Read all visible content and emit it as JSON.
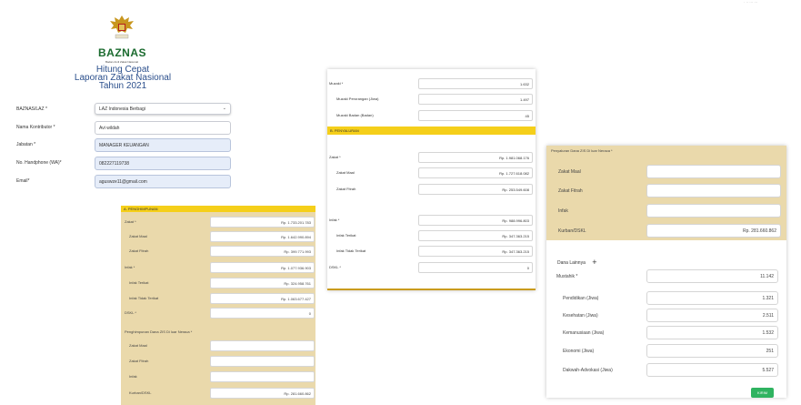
{
  "corner_text": "· ·· ··· ···",
  "header": {
    "logo_text": "BAZNAS",
    "logo_subtext": "Badan Amil Zakat Nasional",
    "title_line1": "Hitung Cepat",
    "title_line2": "Laporan Zakat Nasional",
    "title_line3": "Tahun 2021"
  },
  "form": {
    "baznas_laz": {
      "label": "BAZNAS/LAZ *",
      "value": "LAZ Indonesia Berbagi"
    },
    "kontributor": {
      "label": "Nama Kontributor *",
      "value": "Avi wildah"
    },
    "jabatan": {
      "label": "Jabatan *",
      "value": "MANAGER KEUANGAN"
    },
    "handphone": {
      "label": "No. Handphone (WA)*",
      "value": "082227119738"
    },
    "email": {
      "label": "Email*",
      "value": "aguswze11@gmail.com"
    }
  },
  "penghimpunan": {
    "header": "A. PENGHIMPUNAN",
    "rows": [
      {
        "label": "Zakat *",
        "value": "Rp. 1.733.201.783",
        "indent": false
      },
      {
        "label": "Zakat Maal",
        "value": "Rp. 1.642.990.894",
        "indent": true
      },
      {
        "label": "Zakat Fitrah",
        "value": "Rp. 399.771.993",
        "indent": true
      },
      {
        "label": "Infak *",
        "value": "Rp. 1.077.936.903",
        "indent": false
      },
      {
        "label": "Infak Terikat",
        "value": "Rp. 324.958.761",
        "indent": true
      },
      {
        "label": "Infak Tidak Terikat",
        "value": "Rp. 1.063.677.427",
        "indent": true
      },
      {
        "label": "DSKL *",
        "value": "0",
        "indent": false
      }
    ],
    "neraca_title": "Penghimpunan Dana ZIS Di luar Neraca *",
    "neraca_rows": [
      {
        "label": "Zakat Maal",
        "value": ""
      },
      {
        "label": "Zakat Fitrah",
        "value": ""
      },
      {
        "label": "Infak",
        "value": ""
      },
      {
        "label": "Kurban/DSKL",
        "value": "Rp. 281.660.862"
      }
    ]
  },
  "middle": {
    "top_rows": [
      {
        "label": "Muzaki *",
        "value": "1.632"
      },
      {
        "label": "Muzaki Perorangan (Jiwa)",
        "value": "1.497"
      },
      {
        "label": "Muzaki Badan (Badan)",
        "value": "45"
      }
    ],
    "penyaluran_header": "B. PENYALURAN",
    "zakat_rows": [
      {
        "label": "Zakat *",
        "value": "Rp. 1.981.068.176"
      },
      {
        "label": "Zakat Maal",
        "value": "Rp. 1.727.618.082"
      },
      {
        "label": "Zakat Fitrah",
        "value": "Rp. 253.549.608"
      }
    ],
    "infak_rows": [
      {
        "label": "Infak *",
        "value": "Rp. 988.996.803"
      },
      {
        "label": "Infak Terikat",
        "value": "Rp. 347.363.215"
      },
      {
        "label": "Infak Tidak Terikat",
        "value": "Rp. 347.363.215"
      },
      {
        "label": "DSKL *",
        "value": "0"
      }
    ]
  },
  "right": {
    "neraca_title": "Penyaluran Dana ZIS Di luar Neraca *",
    "neraca_rows": [
      {
        "label": "Zakat Maal",
        "value": ""
      },
      {
        "label": "Zakat Fitrah",
        "value": ""
      },
      {
        "label": "Infak",
        "value": ""
      },
      {
        "label": "Kurban/DSKL",
        "value": "Rp. 281.660.862"
      }
    ],
    "dana_lainnya_label": "Dana Lainnya",
    "plus_symbol": "+",
    "mustahik_rows": [
      {
        "label": "Mustahik *",
        "value": "11.142"
      },
      {
        "label": "Pendidikan (Jiwa)",
        "value": "1.321"
      },
      {
        "label": "Kesehatan (Jiwa)",
        "value": "2.511"
      },
      {
        "label": "Kemanusiaan (Jiwa)",
        "value": "1.532"
      },
      {
        "label": "Ekonomi (Jiwa)",
        "value": "251"
      },
      {
        "label": "Dakwah-Advokasi (Jiwa)",
        "value": "5.527"
      }
    ],
    "submit_label": "KIRIM"
  },
  "colors": {
    "section_header": "#f5cf1a",
    "tan_bg": "#ead9ab",
    "submit_green": "#2fb360",
    "logo_green": "#1b6b2f",
    "title_blue": "#2b4f8c"
  }
}
